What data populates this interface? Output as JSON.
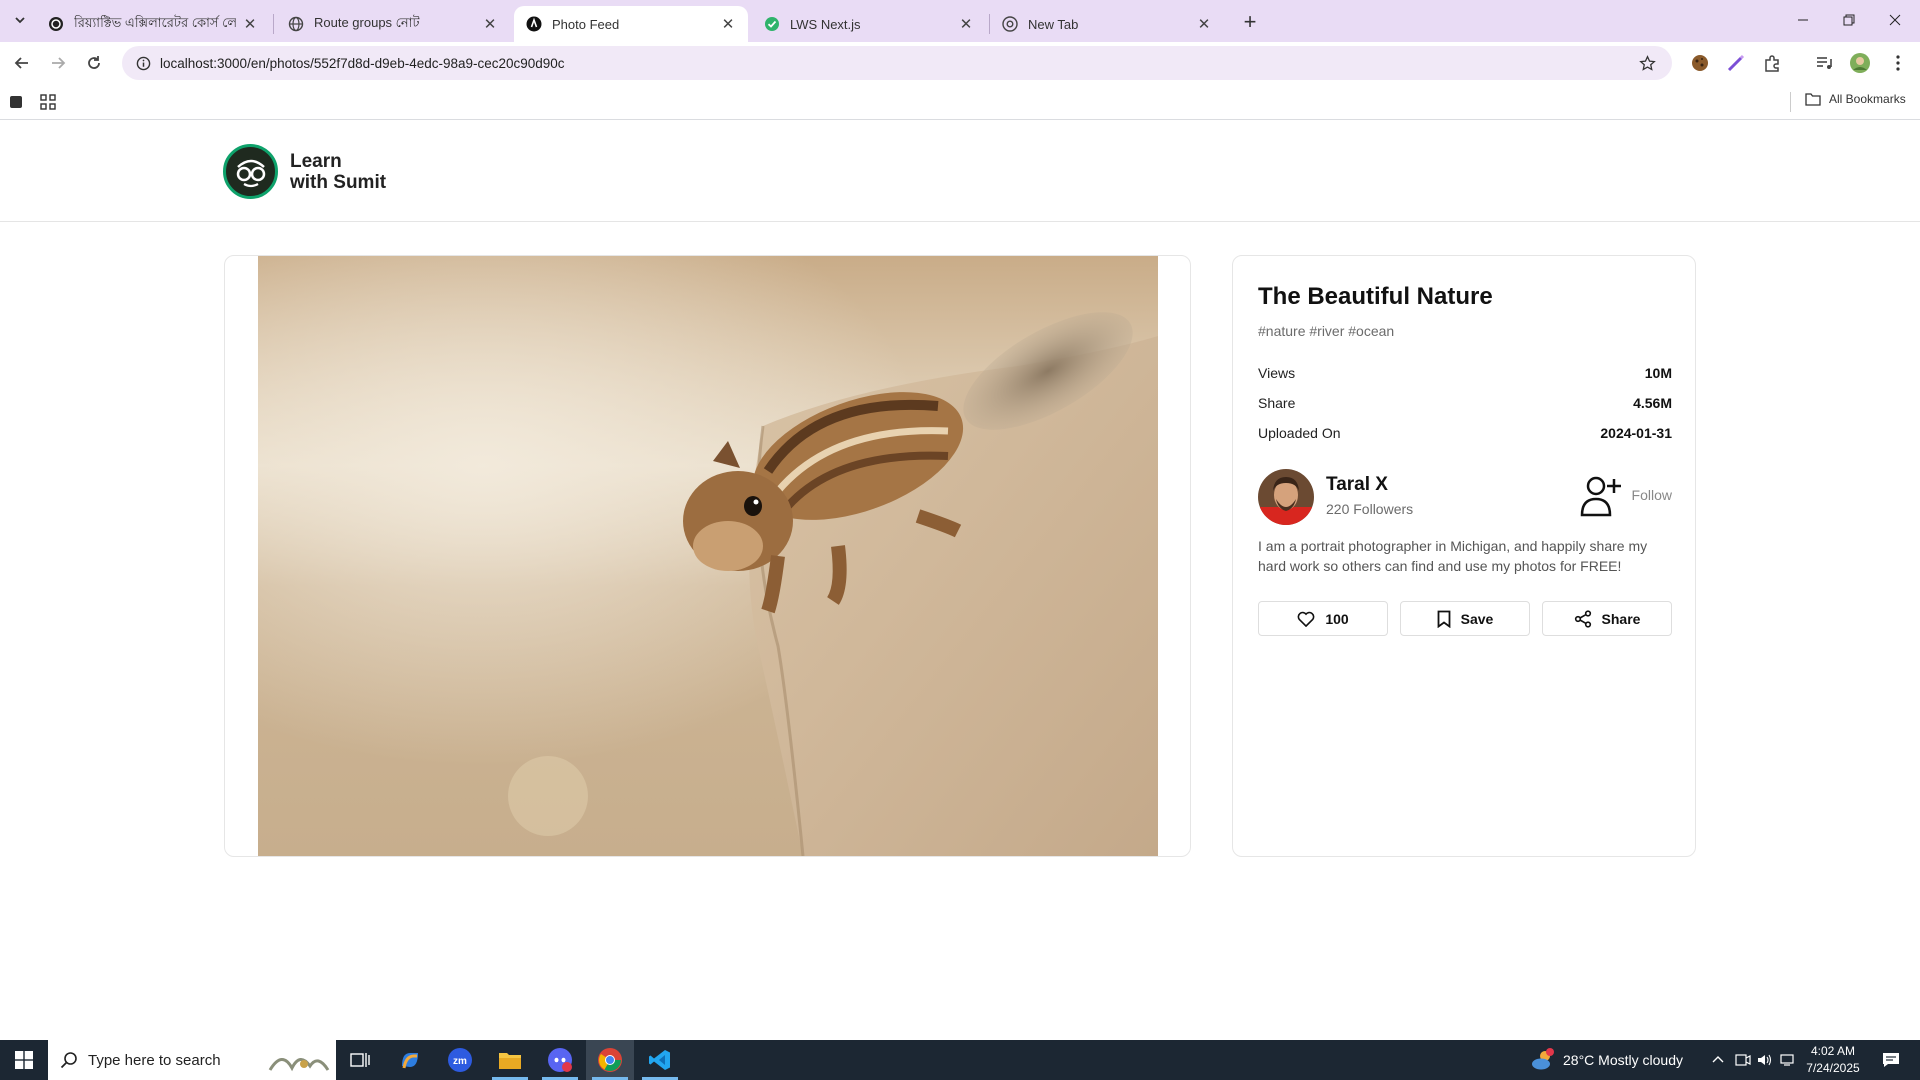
{
  "browser": {
    "tabs": [
      {
        "title": "রিয়্যাক্টিভ এক্সিলারেটর কোর্স লে",
        "active": false
      },
      {
        "title": "Route groups নোট",
        "active": false
      },
      {
        "title": "Photo Feed",
        "active": true
      },
      {
        "title": "LWS Next.js",
        "active": false
      },
      {
        "title": "New Tab",
        "active": false
      }
    ],
    "url": "localhost:3000/en/photos/552f7d8d-d9eb-4edc-98a9-cec20c90d90c",
    "all_bookmarks": "All Bookmarks"
  },
  "site": {
    "logo_line1": "Learn",
    "logo_line2": "with Sumit"
  },
  "photo": {
    "title": "The Beautiful Nature",
    "tags": "#nature #river #ocean",
    "stats": [
      {
        "label": "Views",
        "value": "10M"
      },
      {
        "label": "Share",
        "value": "4.56M"
      },
      {
        "label": "Uploaded On",
        "value": "2024-01-31"
      }
    ],
    "author": {
      "name": "Taral X",
      "followers": "220 Followers",
      "follow_label": "Follow",
      "bio": "I am a portrait photographer in Michigan, and happily share my hard work so others can find and use my photos for FREE!"
    },
    "actions": {
      "likes": "100",
      "save": "Save",
      "share": "Share"
    }
  },
  "taskbar": {
    "search_placeholder": "Type here to search",
    "weather": "28°C  Mostly cloudy",
    "weather_badge": "3",
    "time": "4:02 AM",
    "date": "7/24/2025"
  },
  "colors": {
    "tabstrip": "#e9dcf5",
    "omnibox": "#f1e9f7",
    "logo_ring": "#0ea26b",
    "taskbar": "#1c2733"
  }
}
